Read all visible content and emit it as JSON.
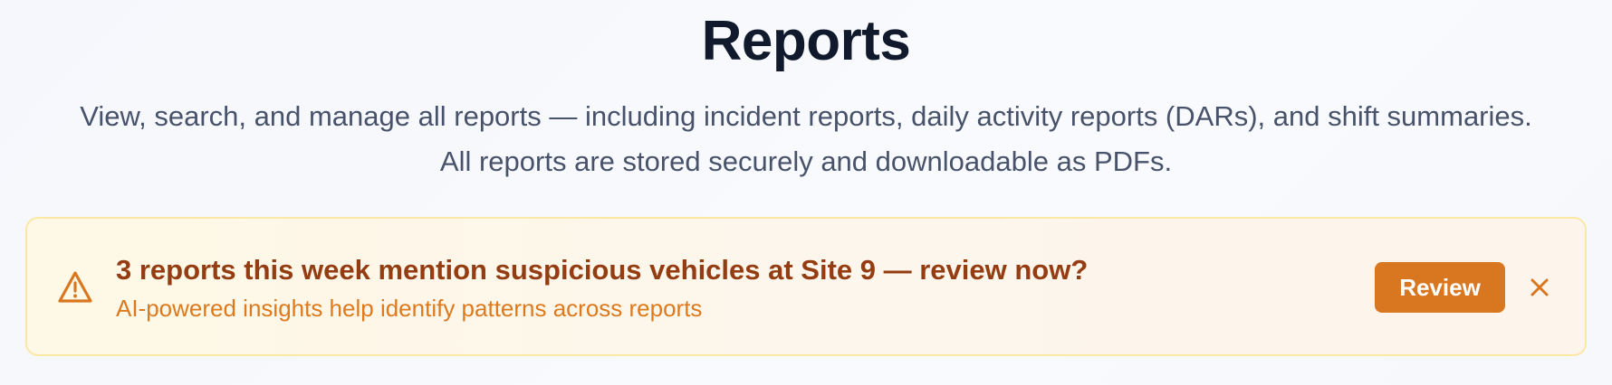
{
  "header": {
    "title": "Reports",
    "description_line1": "View, search, and manage all reports — including incident reports, daily activity reports (DARs), and shift summaries.",
    "description_line2": "All reports are stored securely and downloadable as PDFs."
  },
  "alert": {
    "icon": "warning-triangle-icon",
    "title": "3 reports this week mention suspicious vehicles at Site 9 — review now?",
    "subtitle": "AI-powered insights help identify patterns across reports",
    "review_label": "Review",
    "close_icon": "close-icon",
    "colors": {
      "background": "#fef8e6",
      "border": "#fae8a4",
      "title": "#943d13",
      "subtitle": "#dc7a1d",
      "button": "#d97720"
    }
  }
}
